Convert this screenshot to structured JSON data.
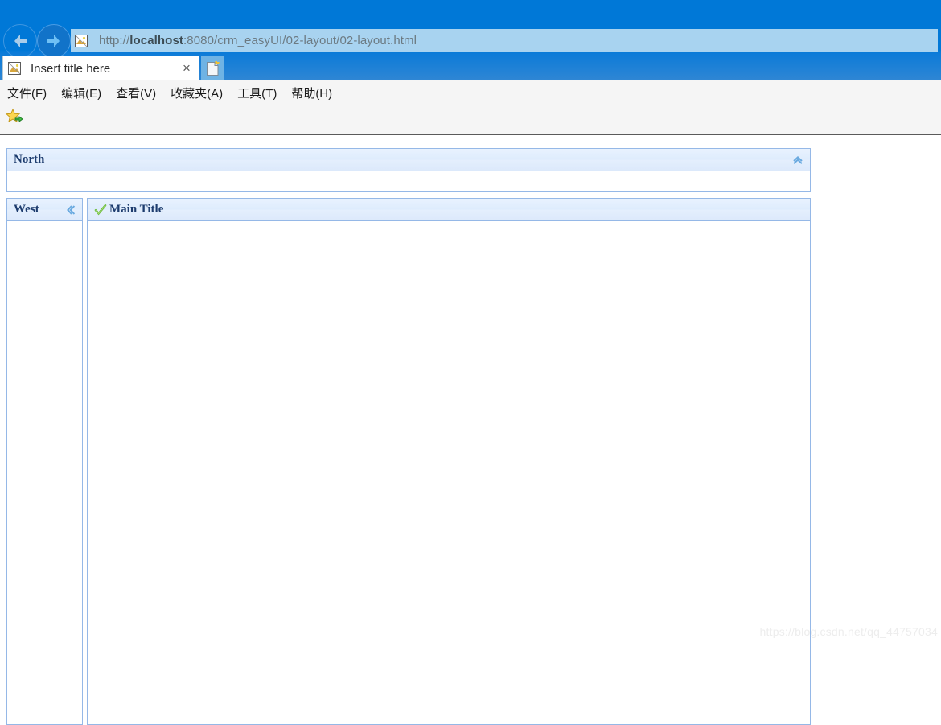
{
  "browser": {
    "back_label": "Back",
    "forward_label": "Forward",
    "url_prefix": "http://",
    "url_host_bold": "localhost",
    "url_rest": ":8080/crm_easyUI/02-layout/02-layout.html",
    "url_full": "http://localhost:8080/crm_easyUI/02-layout/02-layout.html",
    "favicon_name": "broken-image-favicon",
    "tab": {
      "title": "Insert title here",
      "close_label": "×"
    },
    "newtab_label": "New tab",
    "menu": [
      {
        "label": "文件(F)"
      },
      {
        "label": "编辑(E)"
      },
      {
        "label": "查看(V)"
      },
      {
        "label": "收藏夹(A)"
      },
      {
        "label": "工具(T)"
      },
      {
        "label": "帮助(H)"
      }
    ],
    "favorites_icon_name": "add-to-favorites-star-icon"
  },
  "layout": {
    "north": {
      "title": "North",
      "collapse_icon": "chevron-double-up-icon"
    },
    "west": {
      "title": "West",
      "collapse_icon": "chevron-double-left-icon"
    },
    "center": {
      "title": "Main Title",
      "icon": "green-check-icon"
    }
  },
  "watermark": "https://blog.csdn.net/qq_44757034",
  "colors": {
    "chrome_blue": "#0078d7",
    "address_bar": "#a8d3f0",
    "panel_border": "#95b8e7",
    "panel_header_bg": "#deecfd",
    "panel_title_text": "#1d3c6e",
    "tool_icon": "#6aaae0",
    "check_green": "#6cbb3c"
  }
}
